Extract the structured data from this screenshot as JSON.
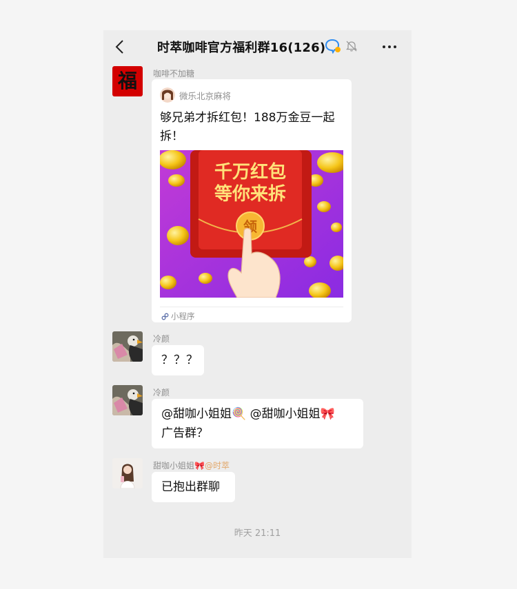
{
  "header": {
    "title": "时萃咖啡官方福利群16(126)"
  },
  "messages": [
    {
      "sender": "咖啡不加糖",
      "avatar_glyph": "福",
      "card": {
        "source": "微乐北京麻将",
        "title": "够兄弟才拆红包！188万金豆一起拆！",
        "image_text": [
          "千万红包",
          "等你来拆"
        ],
        "button_glyph": "领",
        "footer": "小程序"
      }
    },
    {
      "sender": "冷颜",
      "text": "？？？"
    },
    {
      "sender": "冷颜",
      "lines": [
        "@甜咖小姐姐🍭 @甜咖小姐姐🎀",
        "广告群？"
      ]
    },
    {
      "sender": "甜咖小姐姐🎀",
      "sender_mention": "@时萃",
      "text": "已抱出群聊"
    }
  ],
  "timestamp": "昨天 21:11",
  "colors": {
    "background": "#ededed",
    "bubble": "#ffffff",
    "red_packet": "#e02a23",
    "mention_tag": "#e2a76a"
  }
}
